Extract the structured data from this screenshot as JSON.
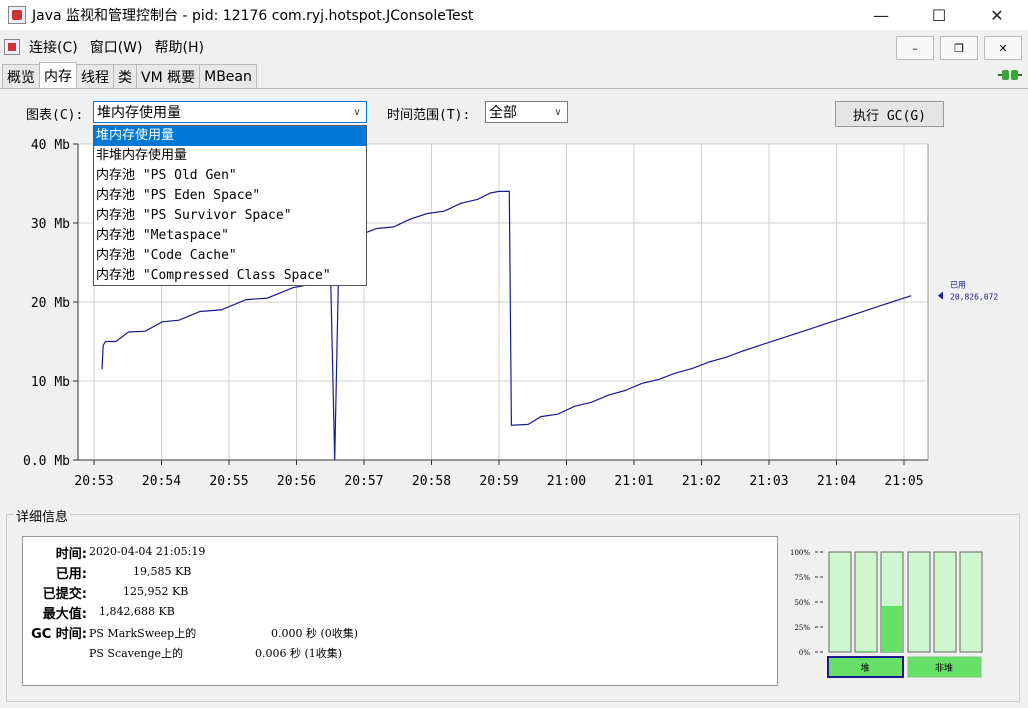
{
  "window": {
    "title": "Java 监视和管理控制台 - pid: 12176 com.ryj.hotspot.JConsoleTest",
    "minimize": "—",
    "maximize": "☐",
    "close": "✕"
  },
  "menu": {
    "items": [
      "连接(C)",
      "窗口(W)",
      "帮助(H)"
    ],
    "mdi_minimize": "–",
    "mdi_restore": "❐",
    "mdi_close": "✕"
  },
  "tabs": [
    "概览",
    "内存",
    "线程",
    "类",
    "VM 概要",
    "MBean"
  ],
  "active_tab": "内存",
  "controls": {
    "chart_label": "图表(C):",
    "chart_selected": "堆内存使用量",
    "chart_options": [
      "堆内存使用量",
      "非堆内存使用量",
      "内存池 \"PS Old Gen\"",
      "内存池 \"PS Eden Space\"",
      "内存池 \"PS Survivor Space\"",
      "内存池 \"Metaspace\"",
      "内存池 \"Code Cache\"",
      "内存池 \"Compressed Class Space\""
    ],
    "range_label": "时间范围(T):",
    "range_selected": "全部",
    "gc_button": "执行 GC(G)"
  },
  "chart_data": {
    "type": "line",
    "series": [
      {
        "name": "已用",
        "color": "#1a1a8c"
      }
    ],
    "current_value_label": "20,826,072",
    "y_ticks": [
      "40 Mb",
      "30 Mb",
      "20 Mb",
      "10 Mb",
      "0.0 Mb"
    ],
    "ylim": [
      0,
      40
    ],
    "x_ticks": [
      "20:53",
      "20:54",
      "20:55",
      "20:56",
      "20:57",
      "20:58",
      "20:59",
      "21:00",
      "21:01",
      "21:02",
      "21:03",
      "21:04",
      "21:05"
    ],
    "points": [
      [
        20.87,
        11.5
      ],
      [
        20.9,
        14.5
      ],
      [
        20.95,
        15
      ],
      [
        21.2,
        15
      ],
      [
        21.5,
        16.2
      ],
      [
        21.9,
        16.3
      ],
      [
        22.3,
        17.5
      ],
      [
        22.7,
        17.7
      ],
      [
        23.2,
        18.8
      ],
      [
        23.7,
        19
      ],
      [
        24.3,
        20.3
      ],
      [
        24.8,
        20.5
      ],
      [
        25.4,
        21.8
      ],
      [
        25.8,
        22.2
      ],
      [
        26.1,
        23
      ],
      [
        26.3,
        24
      ],
      [
        26.4,
        0
      ],
      [
        26.5,
        26
      ],
      [
        26.7,
        27
      ],
      [
        27.0,
        28.5
      ],
      [
        27.4,
        29.3
      ],
      [
        27.8,
        29.5
      ],
      [
        28.2,
        30.5
      ],
      [
        28.6,
        31.2
      ],
      [
        29.0,
        31.5
      ],
      [
        29.4,
        32.5
      ],
      [
        29.8,
        33
      ],
      [
        30.1,
        33.8
      ],
      [
        30.3,
        34
      ],
      [
        30.55,
        34
      ],
      [
        30.6,
        4.4
      ],
      [
        31.0,
        4.5
      ],
      [
        31.3,
        5.5
      ],
      [
        31.7,
        5.8
      ],
      [
        32.1,
        6.8
      ],
      [
        32.5,
        7.3
      ],
      [
        32.9,
        8.2
      ],
      [
        33.3,
        8.8
      ],
      [
        33.7,
        9.7
      ],
      [
        34.1,
        10.2
      ],
      [
        34.5,
        11.0
      ],
      [
        34.9,
        11.6
      ],
      [
        35.3,
        12.4
      ],
      [
        35.7,
        13.0
      ],
      [
        36.1,
        13.8
      ],
      [
        36.5,
        14.5
      ],
      [
        36.9,
        15.2
      ],
      [
        37.3,
        15.9
      ],
      [
        37.7,
        16.6
      ],
      [
        38.1,
        17.3
      ],
      [
        38.5,
        18
      ],
      [
        38.9,
        18.7
      ],
      [
        39.3,
        19.4
      ],
      [
        39.7,
        20.1
      ],
      [
        40.1,
        20.8
      ]
    ]
  },
  "details": {
    "title": "详细信息",
    "rows": [
      {
        "key": "时间:",
        "value": "2020-04-04 21:05:19"
      },
      {
        "key": "已用:",
        "value": "19,585 KB"
      },
      {
        "key": "已提交:",
        "value": "125,952 KB"
      },
      {
        "key": "最大值:",
        "value": "1,842,688 KB"
      },
      {
        "key": "GC 时间:",
        "value": "PS MarkSweep上的",
        "value2": "0.000 秒 (0收集)"
      },
      {
        "key": "",
        "value": "PS Scavenge上的",
        "value2": "0.006 秒 (1收集)"
      }
    ]
  },
  "pool_bars": {
    "ticks": [
      "100%",
      "75%",
      "50%",
      "25%",
      "0%"
    ],
    "heap_levels": [
      0.0,
      0.01,
      0.46
    ],
    "nonheap_levels": [
      0.0,
      0.0,
      0.0
    ],
    "heap_label": "堆",
    "nonheap_label": "非堆",
    "fill_color": "#66e066",
    "empty_color": "#cff7cf"
  }
}
